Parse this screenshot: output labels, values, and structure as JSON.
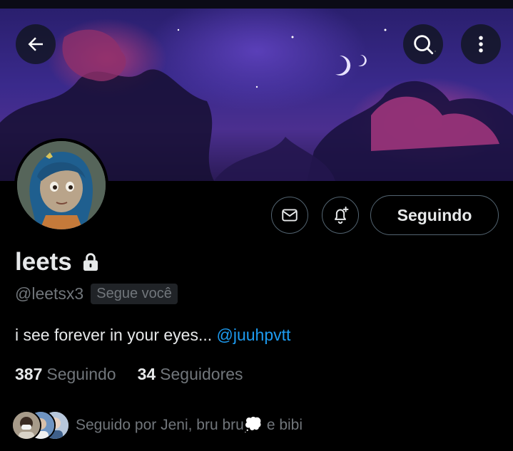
{
  "header": {
    "back_icon": "arrow-left-icon",
    "search_icon": "search-icon",
    "more_icon": "more-vertical-icon"
  },
  "profile": {
    "name": "leets",
    "locked_icon": "lock-icon",
    "handle": "@leetsx3",
    "follows_you": "Segue você",
    "bio_text": "i see forever in your eyes... ",
    "bio_mention": "@juuhpvtt",
    "following_count": "387",
    "following_label": "Seguindo",
    "followers_count": "34",
    "followers_label": "Seguidores",
    "followed_by_text": "Seguido por Jeni, bru bru",
    "followed_by_emoji": "💭",
    "followed_by_suffix": " e bibi"
  },
  "actions": {
    "message_icon": "mail-icon",
    "notify_icon": "bell-plus-icon",
    "follow_button_label": "Seguindo"
  },
  "colors": {
    "background": "#000000",
    "text_primary": "#e7e9ea",
    "text_secondary": "#71767b",
    "accent": "#1d9bf0",
    "border": "#536471"
  }
}
